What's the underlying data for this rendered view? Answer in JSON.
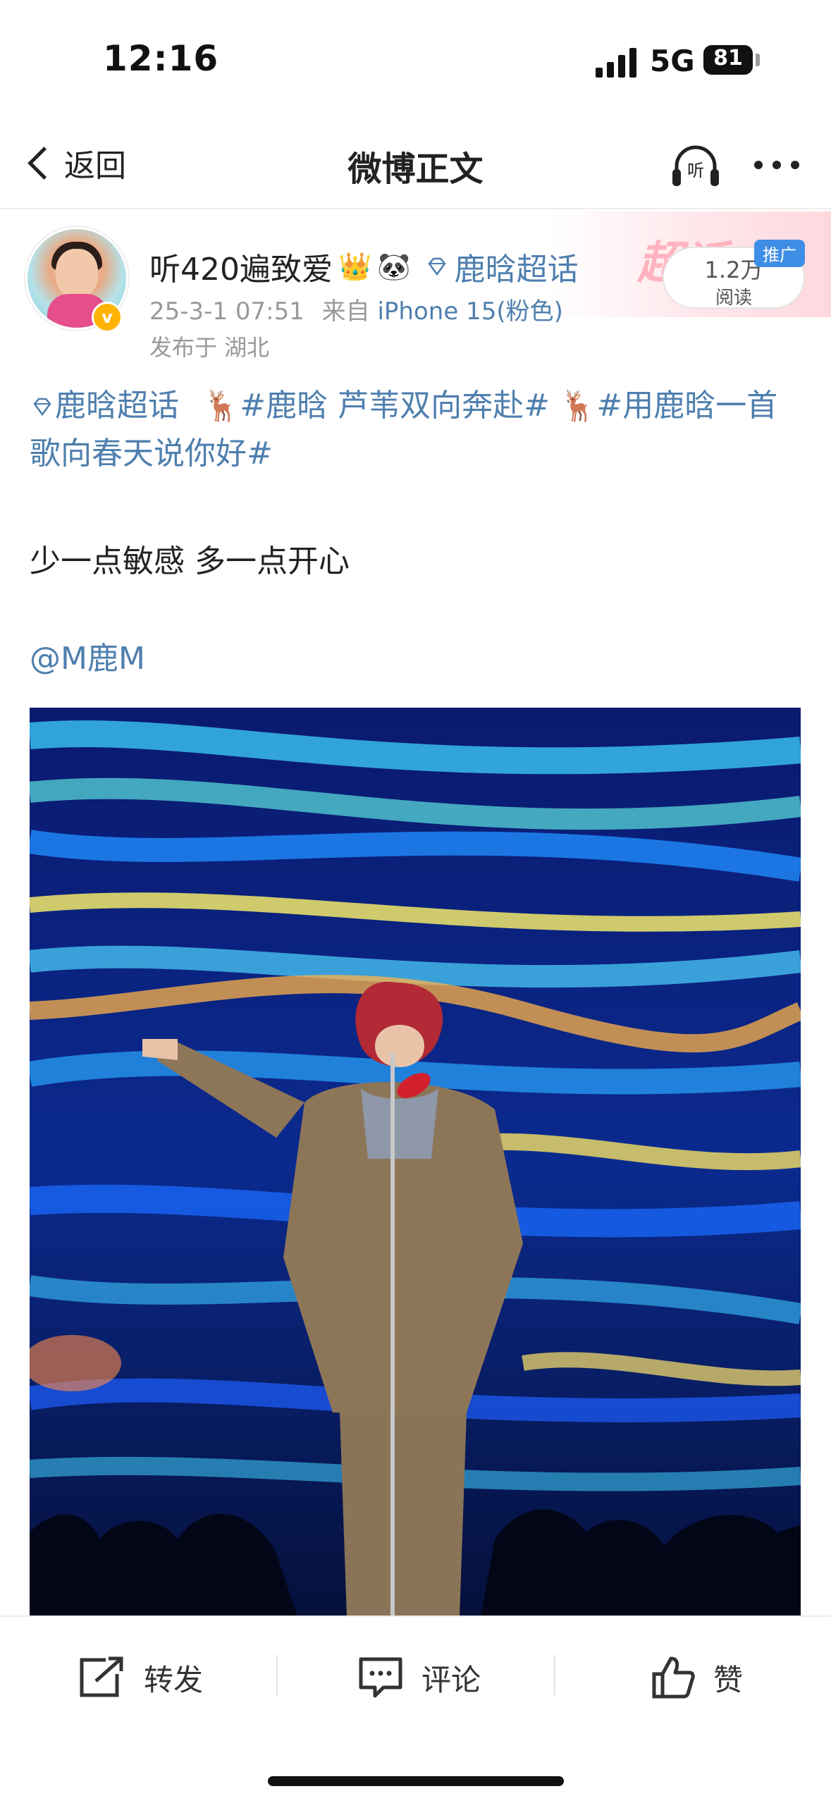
{
  "status_bar": {
    "time": "12:16",
    "network": "5G",
    "battery": "81"
  },
  "nav": {
    "back_label": "返回",
    "title": "微博正文",
    "listen_label": "听"
  },
  "post": {
    "username": "听420遍致爱",
    "badges": [
      "👑",
      "🐼"
    ],
    "super_topic_name": "鹿晗超话",
    "timestamp": "25-3-1 07:51",
    "source_prefix": "来自",
    "source": "iPhone 15(粉色)",
    "location": "发布于 湖北",
    "reads_count": "1.2万",
    "reads_label": "阅读",
    "promo_label": "推广",
    "banner_watermark": "超话",
    "tags_line": [
      {
        "text": "鹿晗超话"
      },
      {
        "emoji": "🦌",
        "text": "#鹿晗 芦苇双向奔赴#"
      },
      {
        "emoji": "🦌",
        "text": "#用鹿晗一首歌向春天说你好#"
      }
    ],
    "body": "少一点敏感 多一点开心",
    "mention": "@M鹿M"
  },
  "actions": {
    "repost": "转发",
    "comment": "评论",
    "like": "赞"
  },
  "colors": {
    "link": "#4f7fae",
    "accent_pink": "#ffb3bf",
    "verified": "#ffb300"
  }
}
